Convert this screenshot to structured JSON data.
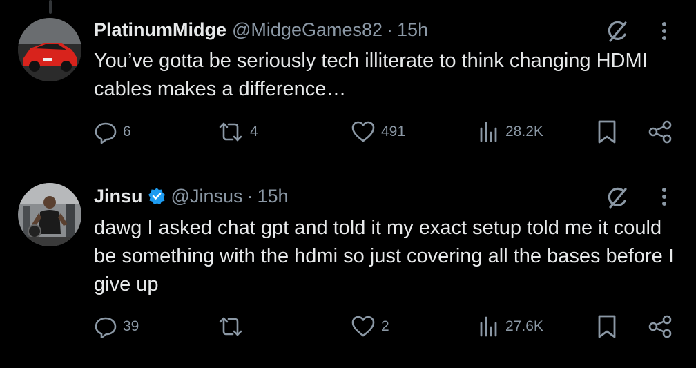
{
  "tweets": [
    {
      "name": "PlatinumMidge",
      "handle": "@MidgeGames82",
      "separator": "·",
      "time": "15h",
      "verified": false,
      "avatar": "red-car-avatar",
      "text": "You’ve gotta be seriously tech illiterate to think changing HDMI cables makes a difference…",
      "replies": "6",
      "retweets": "4",
      "likes": "491",
      "views": "28.2K"
    },
    {
      "name": "Jinsu",
      "handle": "@Jinsus",
      "separator": "·",
      "time": "15h",
      "verified": true,
      "avatar": "gym-person-avatar",
      "text": "dawg I asked chat gpt and told it my exact setup told me it could be something with the hdmi so just covering all the bases before I give up",
      "replies": "39",
      "retweets": "",
      "likes": "2",
      "views": "27.6K"
    }
  ],
  "colors": {
    "background": "#000000",
    "text": "#e7e9ea",
    "muted": "#8b98a5",
    "verified": "#1d9bf0",
    "thread_line": "#333639"
  },
  "icons": [
    "reply-icon",
    "retweet-icon",
    "like-icon",
    "views-icon",
    "bookmark-icon",
    "share-icon",
    "grok-icon",
    "more-icon",
    "verified-badge-icon"
  ]
}
